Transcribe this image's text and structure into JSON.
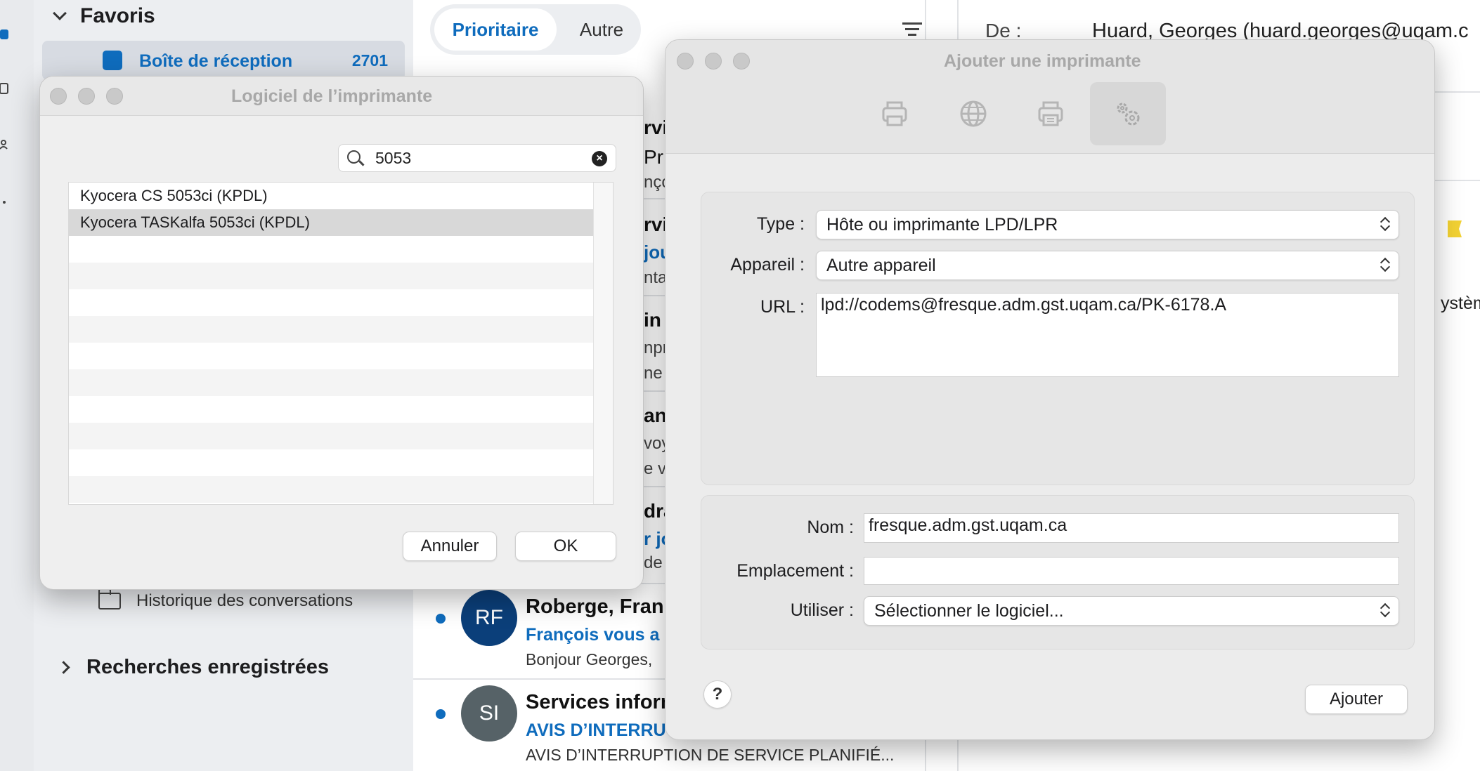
{
  "outlook": {
    "sidebar": {
      "favorites_label": "Favoris",
      "inbox_label": "Boîte de réception",
      "inbox_count": "2701",
      "history_label": "Historique des conversations",
      "saved_searches_label": "Recherches enregistrées"
    },
    "tabs": {
      "priority": "Prioritaire",
      "other": "Autre"
    },
    "partial_fragments": [
      "rvic",
      "Pr",
      "nço",
      "rvi",
      "jou",
      "ntai",
      "in",
      "npr",
      "ne",
      "anc",
      "voy",
      "e v",
      "dra",
      "r jo",
      "de"
    ],
    "messages": [
      {
        "initials": "RF",
        "avatar_color": "#0b3f7a",
        "sender": "Roberge, Fran",
        "subject": "François vous a",
        "preview": "Bonjour Georges,"
      },
      {
        "initials": "SI",
        "avatar_color": "#566267",
        "sender": "Services inforn",
        "subject": "AVIS D’INTERRU",
        "preview": "AVIS D’INTERRUPTION DE SERVICE PLANIFIÉ..."
      }
    ],
    "reading": {
      "from_label": "De :",
      "from_value": "Huard, Georges (huard.georges@uqam.c",
      "system_fragment": "ystèm"
    }
  },
  "software_dialog": {
    "title": "Logiciel de l’imprimante",
    "search_value": "5053",
    "items": [
      {
        "label": "Kyocera CS 5053ci (KPDL)",
        "selected": false
      },
      {
        "label": "Kyocera TASKalfa 5053ci (KPDL)",
        "selected": true
      }
    ],
    "cancel_label": "Annuler",
    "ok_label": "OK"
  },
  "add_printer": {
    "title": "Ajouter une imprimante",
    "toolbar": [
      {
        "icon": "printer-icon",
        "selected": false
      },
      {
        "icon": "globe-icon",
        "selected": false
      },
      {
        "icon": "windows-printer-icon",
        "selected": false
      },
      {
        "icon": "gears-icon",
        "selected": true
      }
    ],
    "type_label": "Type :",
    "type_value": "Hôte ou imprimante LPD/LPR",
    "device_label": "Appareil :",
    "device_value": "Autre appareil",
    "url_label": "URL :",
    "url_value": "lpd://codems@fresque.adm.gst.uqam.ca/PK-6178.A",
    "name_label": "Nom :",
    "name_value": "fresque.adm.gst.uqam.ca",
    "location_label": "Emplacement :",
    "location_value": "",
    "use_label": "Utiliser :",
    "use_value": "Sélectionner le logiciel...",
    "help_label": "?",
    "add_label": "Ajouter"
  },
  "colors": {
    "accent": "#0f6cbd",
    "window_bg": "#ececec",
    "sidebar_bg": "#eceef1"
  }
}
